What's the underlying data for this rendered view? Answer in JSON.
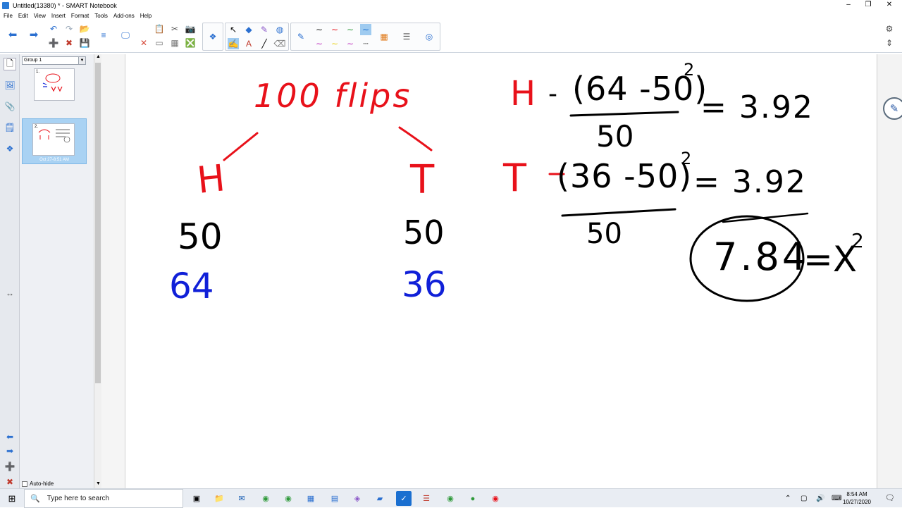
{
  "window": {
    "title": "Untitled(13380) * - SMART Notebook",
    "controls": [
      "–",
      "❐",
      "✕"
    ]
  },
  "menu": [
    "File",
    "Edit",
    "View",
    "Insert",
    "Format",
    "Tools",
    "Add-ons",
    "Help"
  ],
  "sorter": {
    "group_label": "Group 1",
    "slides": [
      {
        "number": "1.",
        "caption": ""
      },
      {
        "number": "2.",
        "caption": "Oct 27-8:51 AM"
      }
    ],
    "autohide_label": "Auto-hide"
  },
  "whiteboard": {
    "tree": {
      "title": "100 flips",
      "left_label": "H",
      "right_label": "T",
      "left_expected": "50",
      "right_expected": "50",
      "left_observed": "64",
      "right_observed": "36"
    },
    "chi_square": {
      "row_h": {
        "label": "H",
        "numerator": "(64 -50)",
        "exponent": "2",
        "denominator": "50",
        "result": "= 3.92"
      },
      "row_t": {
        "label": "T",
        "numerator": "(36 -50)",
        "exponent": "2",
        "denominator": "50",
        "result": "= 3.92"
      },
      "total": "7.84",
      "statistic": "=X",
      "statistic_exponent": "2"
    },
    "colors": {
      "red": "#e8111a",
      "black": "#000000",
      "blue": "#1020d8"
    }
  },
  "taskbar": {
    "search_placeholder": "Type here to search",
    "clock_time": "8:54 AM",
    "clock_date": "10/27/2020"
  }
}
